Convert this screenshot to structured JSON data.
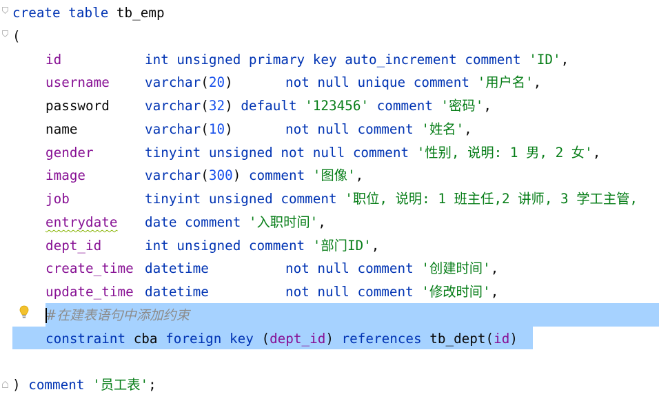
{
  "editor": {
    "language": "SQL",
    "colors": {
      "keyword": "#0033b3",
      "column": "#871094",
      "string": "#067d17",
      "number": "#1750eb",
      "comment": "#8c8c8c",
      "selection": "#a6d2ff"
    },
    "lines": [
      {
        "t": [
          "create table",
          "tb_emp"
        ]
      },
      {
        "t": [
          "("
        ]
      },
      {
        "t": [
          "id",
          "int unsigned primary key auto_increment comment",
          "'ID'",
          ","
        ]
      },
      {
        "t": [
          "username",
          "varchar",
          "(",
          "20",
          ")",
          "not null unique comment",
          "'用户名'",
          ","
        ]
      },
      {
        "t": [
          "password",
          "varchar",
          "(",
          "32",
          ")",
          "default",
          "'123456'",
          "comment",
          "'密码'",
          ","
        ]
      },
      {
        "t": [
          "name",
          "varchar",
          "(",
          "10",
          ")",
          "not null comment",
          "'姓名'",
          ","
        ]
      },
      {
        "t": [
          "gender",
          "tinyint unsigned not null comment",
          "'性别, 说明: 1 男, 2 女'",
          ","
        ]
      },
      {
        "t": [
          "image",
          "varchar",
          "(",
          "300",
          ")",
          "comment",
          "'图像'",
          ","
        ]
      },
      {
        "t": [
          "job",
          "tinyint unsigned comment",
          "'职位, 说明: 1 班主任,2 讲师, 3 学工主管,"
        ]
      },
      {
        "t": [
          "entrydate",
          "date comment",
          "'入职时间'",
          ","
        ]
      },
      {
        "t": [
          "dept_id",
          "int unsigned comment",
          "'部门ID'",
          ","
        ]
      },
      {
        "t": [
          "create_time",
          "datetime",
          "not null comment",
          "'创建时间'",
          ","
        ]
      },
      {
        "t": [
          "update_time",
          "datetime",
          "not null comment",
          "'修改时间'",
          ","
        ]
      },
      {
        "t": [
          "#在建表语句中添加约束"
        ]
      },
      {
        "t": [
          "constraint",
          "cba",
          "foreign key",
          "(",
          "dept_id",
          ")",
          "references",
          "tb_dept",
          "(",
          "id",
          ")"
        ]
      },
      {
        "t": [
          ")",
          "comment",
          "'员工表'",
          ";"
        ]
      }
    ],
    "icons": {
      "intention": "lightbulb-icon",
      "fold": "fold-marker-icon"
    }
  }
}
